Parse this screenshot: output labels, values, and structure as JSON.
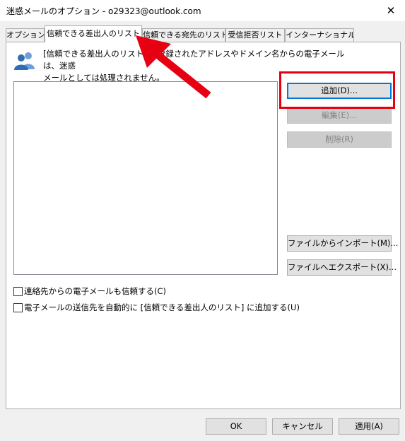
{
  "window": {
    "title": "迷惑メールのオプション - o29323@outlook.com",
    "close_glyph": "✕"
  },
  "tabs": [
    {
      "label": "オプション",
      "active": false
    },
    {
      "label": "信頼できる差出人のリスト",
      "active": true
    },
    {
      "label": "信頼できる宛先のリスト",
      "active": false
    },
    {
      "label": "受信拒否リスト",
      "active": false
    },
    {
      "label": "インターナショナル",
      "active": false
    }
  ],
  "panel": {
    "description_line1": "[信頼できる差出人のリスト] に登録されたアドレスやドメイン名からの電子メールは、迷惑",
    "description_line2": "メールとしては処理されません。",
    "buttons": {
      "add": "追加(D)...",
      "edit": "編集(E)...",
      "remove": "削除(R)",
      "import": "ファイルからインポート(M)...",
      "export": "ファイルへエクスポート(X)..."
    },
    "checkboxes": {
      "trust_contacts": {
        "label": "連絡先からの電子メールも信頼する(C)",
        "checked": false
      },
      "auto_add": {
        "label": "電子メールの送信先を自動的に [信頼できる差出人のリスト] に追加する(U)",
        "checked": false
      }
    }
  },
  "footer": {
    "ok": "OK",
    "cancel": "キャンセル",
    "apply": "適用(A)"
  },
  "annotations": {
    "highlight_color": "#e60012",
    "arrow_color": "#e60012"
  }
}
